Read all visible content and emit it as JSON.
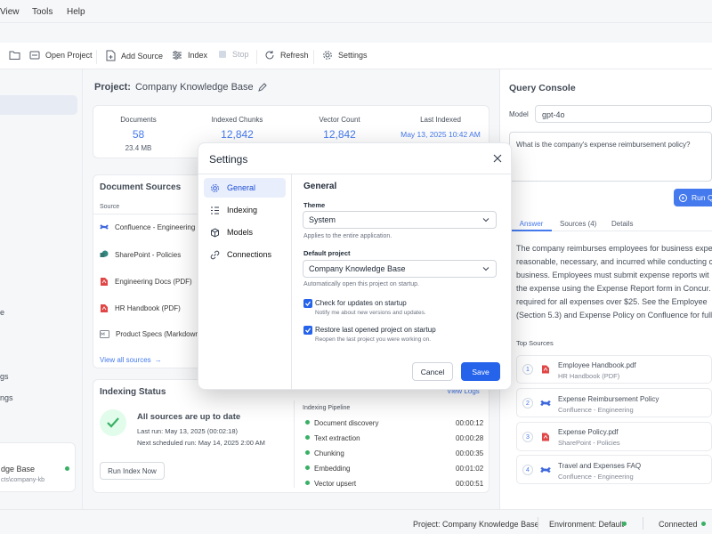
{
  "menu": {
    "view": "View",
    "tools": "Tools",
    "help": "Help"
  },
  "toolbar": {
    "open_project": "Open Project",
    "add_source": "Add Source",
    "index": "Index",
    "stop": "Stop",
    "refresh": "Refresh",
    "settings": "Settings"
  },
  "sidebar": {
    "frag_a": "e",
    "frag_b": "gs",
    "frag_c": "ngs",
    "project_name": "dge Base",
    "project_path": "cts\\company-kb"
  },
  "project": {
    "label": "Project:",
    "name": "Company Knowledge Base"
  },
  "stats": [
    {
      "label": "Documents",
      "value": "58",
      "sub": "23.4 MB"
    },
    {
      "label": "Indexed Chunks",
      "value": "12,842",
      "sub": ""
    },
    {
      "label": "Vector Count",
      "value": "12,842",
      "sub": ""
    },
    {
      "label": "Last Indexed",
      "value": "May 13, 2025 10:42 AM",
      "sub": ""
    }
  ],
  "sources": {
    "title": "Document Sources",
    "col": "Source",
    "items": [
      {
        "name": "Confluence - Engineering",
        "icon": "confluence-icon"
      },
      {
        "name": "SharePoint - Policies",
        "icon": "sharepoint-icon"
      },
      {
        "name": "Engineering Docs (PDF)",
        "icon": "pdf-icon"
      },
      {
        "name": "HR Handbook (PDF)",
        "icon": "pdf-icon"
      },
      {
        "name": "Product Specs (Markdown)",
        "icon": "markdown-icon"
      }
    ],
    "view_all": "View all sources"
  },
  "indexing": {
    "title": "Indexing Status",
    "view_logs": "View Logs",
    "headline": "All sources are up to date",
    "last_run": "Last run: May 13, 2025 (00:02:18)",
    "next_run": "Next scheduled run: May 14, 2025 2:00 AM",
    "run_button": "Run Index Now",
    "pipeline_title": "Indexing Pipeline",
    "pipeline": [
      {
        "step": "Document discovery",
        "time": "00:00:12"
      },
      {
        "step": "Text extraction",
        "time": "00:00:28"
      },
      {
        "step": "Chunking",
        "time": "00:00:35"
      },
      {
        "step": "Embedding",
        "time": "00:01:02"
      },
      {
        "step": "Vector upsert",
        "time": "00:00:51"
      }
    ]
  },
  "console": {
    "title": "Query Console",
    "model_label": "Model",
    "model": "gpt-4o",
    "query": "What is the company's expense reimbursement policy?",
    "run": "Run Q",
    "tabs": [
      "Answer",
      "Sources (4)",
      "Details"
    ],
    "answer_lines": [
      "The company reimburses employees for business expe",
      "reasonable, necessary, and incurred while conducting c",
      "business. Employees must submit expense reports wit",
      "the expense using the Expense Report form in Concur.",
      "required for all expenses over $25.   See the Employee",
      "(Section 5.3) and Expense Policy on Confluence for full"
    ],
    "top_sources_title": "Top Sources",
    "top_sources": [
      {
        "n": "1",
        "title": "Employee Handbook.pdf",
        "sub": "HR Handbook (PDF)",
        "icon": "pdf-icon"
      },
      {
        "n": "2",
        "title": "Expense Reimbursement Policy",
        "sub": "Confluence - Engineering",
        "icon": "confluence-icon"
      },
      {
        "n": "3",
        "title": "Expense Policy.pdf",
        "sub": "SharePoint - Policies",
        "icon": "pdf-icon"
      },
      {
        "n": "4",
        "title": "Travel and Expenses FAQ",
        "sub": "Confluence - Engineering",
        "icon": "confluence-icon"
      }
    ]
  },
  "statusbar": {
    "project": "Project:  Company Knowledge Base",
    "environment": "Environment:  Default",
    "connection": "Connected"
  },
  "dialog": {
    "title": "Settings",
    "nav": [
      "General",
      "Indexing",
      "Models",
      "Connections"
    ],
    "section": "General",
    "theme_label": "Theme",
    "theme_value": "System",
    "theme_help": "Applies to the entire application.",
    "project_label": "Default project",
    "project_value": "Company Knowledge Base",
    "project_help": "Automatically open this project on startup.",
    "check1_label": "Check for updates on startup",
    "check1_help": "Notify me about new versions and updates.",
    "check2_label": "Restore last opened project on startup",
    "check2_help": "Reopen the last project you were working on.",
    "cancel": "Cancel",
    "save": "Save"
  },
  "colors": {
    "accent": "#2563eb",
    "success": "#16a34a",
    "pdf": "#dc2626",
    "confluence": "#1d4ed8",
    "sharepoint": "#0f766e"
  }
}
